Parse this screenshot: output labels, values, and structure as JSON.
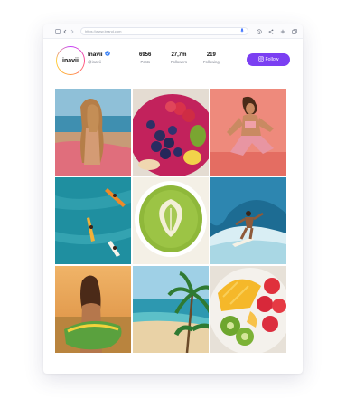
{
  "browser": {
    "url": "https://www.brand.com",
    "icons": [
      "back-icon",
      "forward-icon",
      "tab-icon",
      "mic-icon",
      "history-icon",
      "share-icon",
      "new-tab-icon",
      "tabs-icon"
    ]
  },
  "profile": {
    "avatar_text": "inavii",
    "name": "Inavii",
    "handle": "@inavii",
    "verified": true,
    "stats": [
      {
        "value": "6956",
        "label": "Posts"
      },
      {
        "value": "27,7m",
        "label": "Followers"
      },
      {
        "value": "219",
        "label": "Following"
      }
    ],
    "follow_label": "Follow",
    "accent": "#7b3ff2"
  },
  "posts": [
    {
      "subject": "woman-surfboard-beach"
    },
    {
      "subject": "acai-bowl"
    },
    {
      "subject": "woman-sitting-pink-wall"
    },
    {
      "subject": "aerial-surfers-ocean"
    },
    {
      "subject": "matcha-latte"
    },
    {
      "subject": "surfer-riding-wave"
    },
    {
      "subject": "woman-surfboard-sunset"
    },
    {
      "subject": "tropical-beach-palms"
    },
    {
      "subject": "fruit-bowl"
    }
  ]
}
